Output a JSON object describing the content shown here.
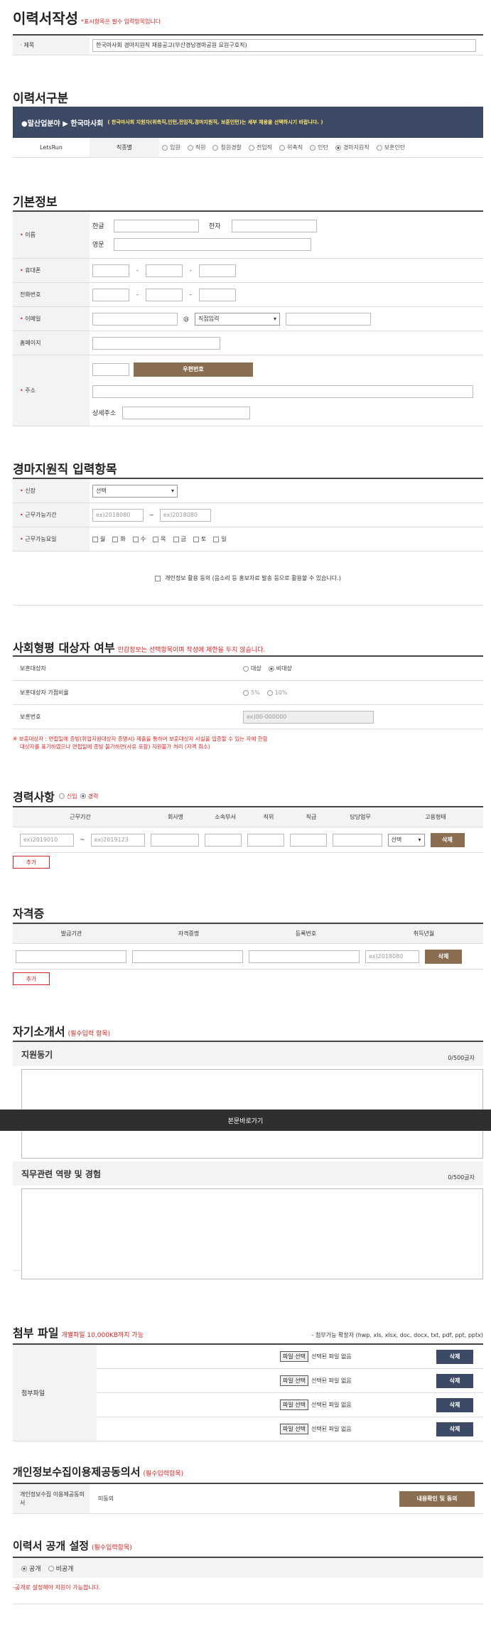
{
  "page_title": "이력서작성",
  "page_note": "*표시항목은 필수 입력항목입니다",
  "subject": {
    "label": "제목",
    "value": "한국마사회 경마지원직 채용공고(부산경남경마공원 요원구호직)"
  },
  "division": {
    "title": "이력서구분",
    "banner_prefix": "●말산업분야 ▶ 한국마사회",
    "banner_note": "( 한국마사회 지원자(위촉직,인턴,전임직,경마지원직, 보훈인턴)는 세부 채용을 선택하시기 바랍니다. )",
    "row_label": "LetsRun",
    "row_sublabel": "직종별",
    "options": [
      "임원",
      "직원",
      "청원경찰",
      "전임직",
      "위촉직",
      "인턴",
      "경마지원직",
      "보훈인턴"
    ],
    "selected": "경마지원직"
  },
  "basic": {
    "title": "기본정보",
    "name_label": "이름",
    "korean": "한글",
    "hanja": "한자",
    "english": "영문",
    "phone_label": "휴대폰",
    "tel_label": "전화번호",
    "email_label": "이메일",
    "email_select": "직접입력",
    "home_label": "홈페이지",
    "address_label": "주소",
    "postcode_btn": "우편번호",
    "detail_label": "상세주소"
  },
  "horse": {
    "title": "경마지원직 입력항목",
    "height_label": "신장",
    "height_select": "선택",
    "period_label": "근무가능기간",
    "period_from": "ex)2018080",
    "period_to": "ex)2018080",
    "days_label": "근무가능요일",
    "days": [
      "월",
      "화",
      "수",
      "목",
      "금",
      "토",
      "일"
    ],
    "consent": "개인정보 활용 동의 (음소리 등 홍보자료 발송 등으로 활용할 수 있습니다.)"
  },
  "social": {
    "title": "사회형평 대상자 여부",
    "note": "민감정보는 선택항목이며 작성에 제한을 두지 않습니다.",
    "veteran_label": "보훈대상자",
    "veteran_options": [
      "대상",
      "비대상"
    ],
    "veteran_selected": "비대상",
    "bonus_label": "보훈대상자 가점비율",
    "bonus_options": [
      "5%",
      "10%"
    ],
    "number_label": "보훈번호",
    "number_placeholder": "ex)00-000000",
    "warn1": "※ 보훈대상자 : 면접일에 증빙(취업지원대상자 증명서) 제출을 통하여 보훈대상자 사실을 입증할 수 있는 자에 한함",
    "warn2": "대상자를 표기하였으나 면접일에 증빙 불가하면(사유 포함) 지원불가 처리 (자격 취소)"
  },
  "career": {
    "title": "경력사항",
    "options": [
      "신입",
      "경력"
    ],
    "selected": "경력",
    "columns": [
      "근무기간",
      "회사명",
      "소속부서",
      "직위",
      "직급",
      "담당업무",
      "고용형태"
    ],
    "from": "ex)2019010",
    "to": "ex)2019123",
    "type_select": "선택",
    "delete": "삭제",
    "add": "추가"
  },
  "license": {
    "title": "자격증",
    "columns": [
      "발급기관",
      "자격증명",
      "등록번호",
      "취득년월"
    ],
    "date": "ex)2018080",
    "delete": "삭제",
    "add": "추가"
  },
  "intro": {
    "title": "자기소개서",
    "note": "(필수입력 항목)",
    "q1": "지원동기",
    "q1_count": "0/500글자",
    "skip": "본문바로가기",
    "q2": "직무관련 역량 및 경험",
    "q2_count": "0/500글자"
  },
  "attach": {
    "title": "첨부 파일",
    "note": "개별파일 10,000KB까지 가능",
    "ext": "- 첨부가능 확장자 (hwp, xls, xlsx, doc, docx, txt, pdf, ppt, pptx)",
    "row_label": "첨부파일",
    "file_btn": "파일 선택",
    "no_file": "선택된 파일 없음",
    "delete": "삭제"
  },
  "privacy": {
    "title": "개인정보수집이용제공동의서",
    "note": "(필수입력항목)",
    "label": "개인정보수집 이용제공동의서",
    "status": "미동의",
    "btn": "내용확인 및 동의"
  },
  "publish": {
    "title": "이력서 공개 설정",
    "note": "(필수입력항목)",
    "options": [
      "공개",
      "비공개"
    ],
    "selected": "공개",
    "warn": "-공개로 설정해야 지원이 가능합니다."
  }
}
